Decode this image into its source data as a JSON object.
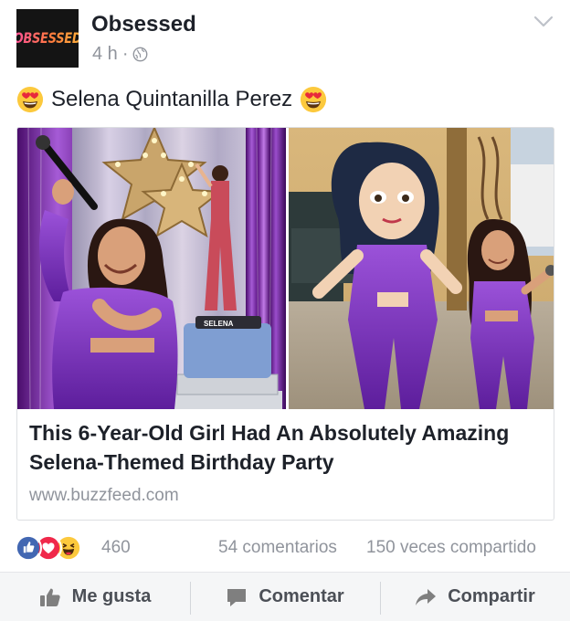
{
  "post": {
    "page_name": "Obsessed",
    "avatar_text": "OBSESSED",
    "timestamp": "4 h",
    "separator": "·",
    "privacy_icon": "globe-icon",
    "menu_icon": "chevron-down-icon",
    "emoji_icon": "heart-eyes-emoji-icon",
    "text": "Selena Quintanilla Perez"
  },
  "link_card": {
    "title": "This 6-Year-Old Girl Had An Absolutely Amazing Selena-Themed Birthday Party",
    "domain": "www.buzzfeed.com",
    "image_label": "SELENA"
  },
  "stats": {
    "reaction_icons": [
      "like-reaction-icon",
      "love-reaction-icon",
      "haha-reaction-icon"
    ],
    "reaction_count": "460",
    "comments": "54 comentarios",
    "shares": "150 veces compartido"
  },
  "actions": {
    "like": "Me gusta",
    "comment": "Comentar",
    "share": "Compartir"
  },
  "colors": {
    "like_blue": "#3b5998",
    "love_red": "#f0284a",
    "haha_yellow": "#fcc93d",
    "meta_gray": "#90949c",
    "action_gray": "#4b4f56",
    "purple_outfit": "#7a2fb8",
    "tinsel_purple": "#6a1c8f"
  }
}
